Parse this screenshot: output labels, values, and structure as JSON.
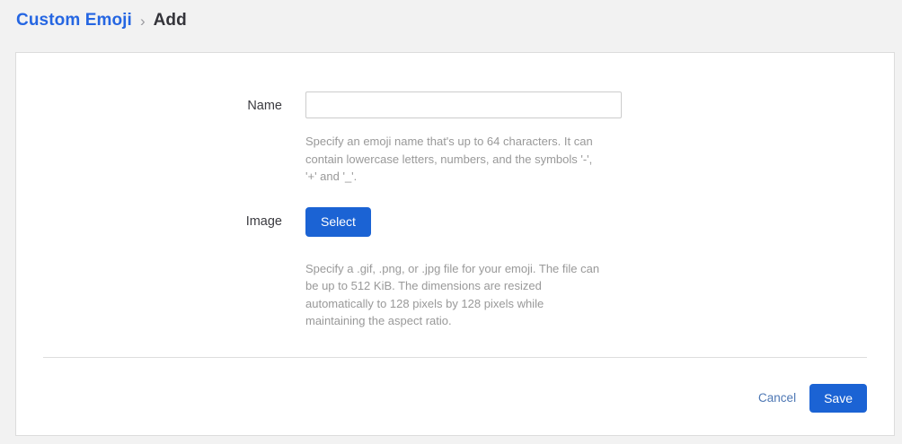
{
  "breadcrumb": {
    "link": "Custom Emoji",
    "separator": "›",
    "current": "Add"
  },
  "form": {
    "name": {
      "label": "Name",
      "value": "",
      "help": "Specify an emoji name that's up to 64 characters. It can\ncontain lowercase letters, numbers, and the symbols '-',\n'+' and '_'."
    },
    "image": {
      "label": "Image",
      "button": "Select",
      "help": "Specify a .gif, .png, or .jpg file for your emoji. The file can\nbe up to 512 KiB. The dimensions are resized\nautomatically to 128 pixels by 128 pixels while\nmaintaining the aspect ratio."
    },
    "footer": {
      "cancel": "Cancel",
      "save": "Save"
    }
  },
  "colors": {
    "page_bg": "#f2f2f2",
    "card_bg": "#ffffff",
    "card_border": "#dcdcdc",
    "link": "#2566e2",
    "heading": "#34343a",
    "label": "#3b3b40",
    "helper": "#999999",
    "input_border": "#cccccc",
    "divider": "#dedede",
    "primary": "#1b63d4",
    "primary_text": "#ffffff",
    "cancel": "#4d77b4"
  }
}
